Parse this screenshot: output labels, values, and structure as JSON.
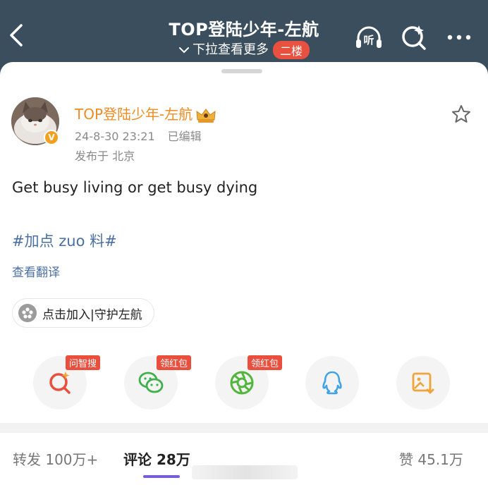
{
  "header": {
    "title": "TOP登陆少年-左航",
    "subtitle": "下拉查看更多",
    "floor_badge": "二楼",
    "listen_label": "听"
  },
  "post": {
    "author": "TOP登陆少年-左航",
    "verified_badge": "V",
    "date": "24-8-30 23:21",
    "edited": "已编辑",
    "location": "发布于 北京",
    "text": "Get busy living or get busy dying",
    "hashtag": "#加点 zuo 料#",
    "translate_label": "查看翻译",
    "join_label": "点击加入|守护左航"
  },
  "share": {
    "tags": [
      "问智搜",
      "领红包",
      "领红包"
    ]
  },
  "tabs": {
    "repost": "转发 100万+",
    "comments": "评论 28万",
    "likes": "赞 45.1万"
  },
  "colors": {
    "header_bg": "#3b4e5e",
    "username": "#f08b23",
    "link": "#4a6fa5",
    "tag_red": "#ea4e3d",
    "tab_indicator": "#7a5cd6"
  },
  "icons": [
    "chevron-left-icon",
    "listen-icon",
    "search-icon",
    "more-icon",
    "star-icon",
    "crown-icon",
    "ai-search-icon",
    "wechat-icon",
    "moments-icon",
    "qq-icon",
    "save-image-icon"
  ]
}
